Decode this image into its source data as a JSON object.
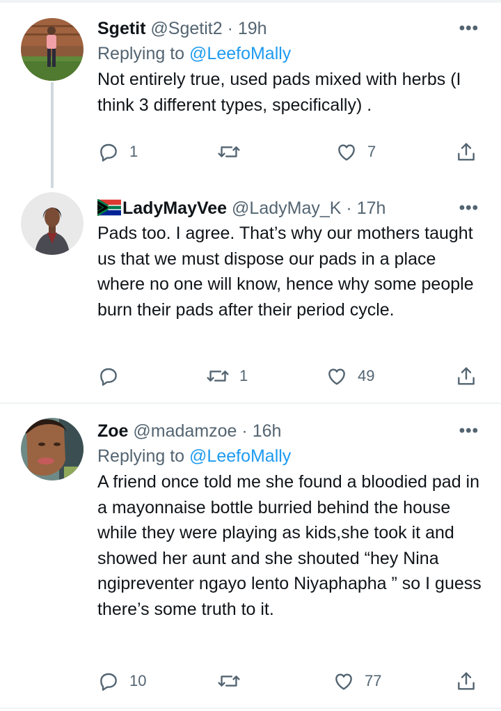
{
  "tweets": [
    {
      "name": "Sgetit",
      "handle": "@Sgetit2",
      "separator": "·",
      "time": "19h",
      "replying_prefix": "Replying to",
      "replying_to": "@LeefoMally",
      "text": "Not entirely true, used pads mixed with herbs (I think 3 different types, specifically) .",
      "replies": "1",
      "retweets": "",
      "likes": "7"
    },
    {
      "name": "LadyMayVee",
      "flag": "south-africa-flag-emoji",
      "handle": "@LadyMay_K",
      "separator": "·",
      "time": "17h",
      "text": "Pads too. I agree. That’s why our mothers taught us that we must dispose our pads in a place where no one will know, hence why some people burn their pads after their period cycle.",
      "replies": "",
      "retweets": "1",
      "likes": "49"
    },
    {
      "name": "Zoe",
      "handle": "@madamzoe",
      "separator": "·",
      "time": "16h",
      "replying_prefix": "Replying to",
      "replying_to": "@LeefoMally",
      "text": "A friend once told me she found a bloodied pad in a mayonnaise bottle burried behind the house while they were playing as kids,she took it and showed her aunt and she shouted “hey Nina ngipreventer ngayo lento Niyaphapha ” so I guess there’s some truth to it.",
      "replies": "10",
      "retweets": "",
      "likes": "77"
    }
  ],
  "more_glyph": "•••",
  "icons": [
    "reply-icon",
    "retweet-icon",
    "like-icon",
    "share-icon",
    "more-icon"
  ],
  "colors": {
    "link": "#1d9bf0",
    "secondary": "#536471",
    "text": "#0f1419",
    "divider": "#eff3f4"
  }
}
